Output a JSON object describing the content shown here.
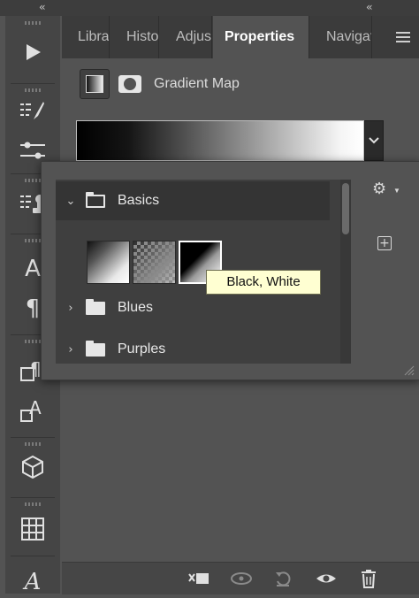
{
  "panel": {
    "tabs": [
      {
        "label": "Libraries"
      },
      {
        "label": "History"
      },
      {
        "label": "Adjustments"
      },
      {
        "label": "Properties"
      },
      {
        "label": "Navigator"
      }
    ],
    "active_tab": "Properties",
    "adjustment_title": "Gradient Map"
  },
  "gradient_picker": {
    "folders": [
      {
        "label": "Basics",
        "expanded": true
      },
      {
        "label": "Blues",
        "expanded": false
      },
      {
        "label": "Purples",
        "expanded": false
      }
    ],
    "tooltip": "Black, White"
  },
  "colors": {
    "panel_bg": "#535353",
    "toolbar_bg": "#454545",
    "tab_bar_bg": "#3b3b3b",
    "tooltip_bg": "#ffffd2"
  },
  "icons": {
    "toolbar": [
      "play-icon",
      "brush-presets-icon",
      "adjustments-sliders-icon",
      "clone-source-icon",
      "character-icon",
      "paragraph-icon",
      "paragraph-styles-icon",
      "character-styles-icon",
      "3d-cube-icon",
      "glyph-grid-icon",
      "glyphs-icon"
    ],
    "bottom": [
      "clip-to-layer-icon",
      "view-previous-icon",
      "reset-icon",
      "visibility-icon",
      "delete-icon"
    ]
  }
}
